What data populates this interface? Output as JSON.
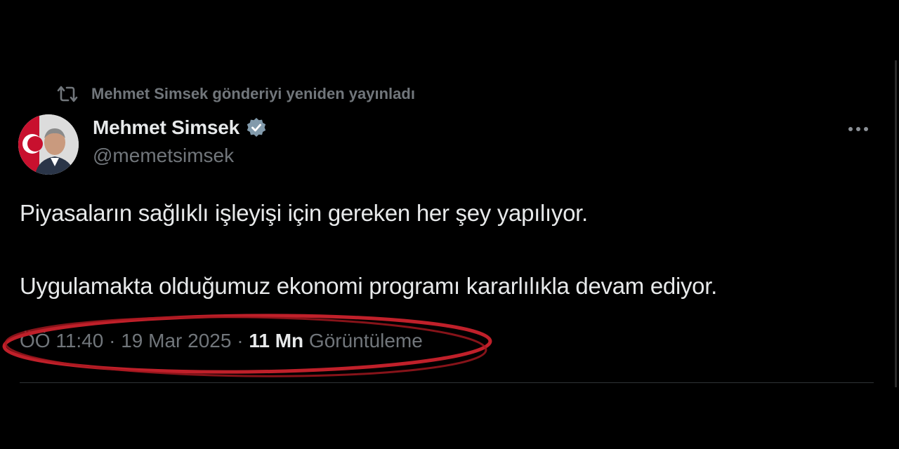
{
  "retweet": {
    "label": "Mehmet Simsek gönderiyi yeniden yayınladı",
    "icon": "retweet-icon"
  },
  "author": {
    "display_name": "Mehmet Simsek",
    "handle": "@memetsimsek",
    "verified": true,
    "verified_icon": "verified-badge-icon",
    "avatar_icon": "profile-photo"
  },
  "tweet": {
    "paragraphs": [
      "Piyasaların sağlıklı işleyişi için gereken her şey yapılıyor.",
      "Uygulamakta olduğumuz ekonomi programı kararlılıkla devam ediyor."
    ]
  },
  "meta": {
    "time": "ÖÖ 11:40",
    "separator": " · ",
    "date": "19 Mar 2025",
    "views_count": "11 Mn",
    "views_label": "Görüntüleme"
  },
  "colors": {
    "background": "#000000",
    "primary_text": "#e7e9ea",
    "secondary_text": "#71767b",
    "verified_badge": "#829aab",
    "highlight_annotation": "#c0202a",
    "divider": "#2f3336"
  }
}
